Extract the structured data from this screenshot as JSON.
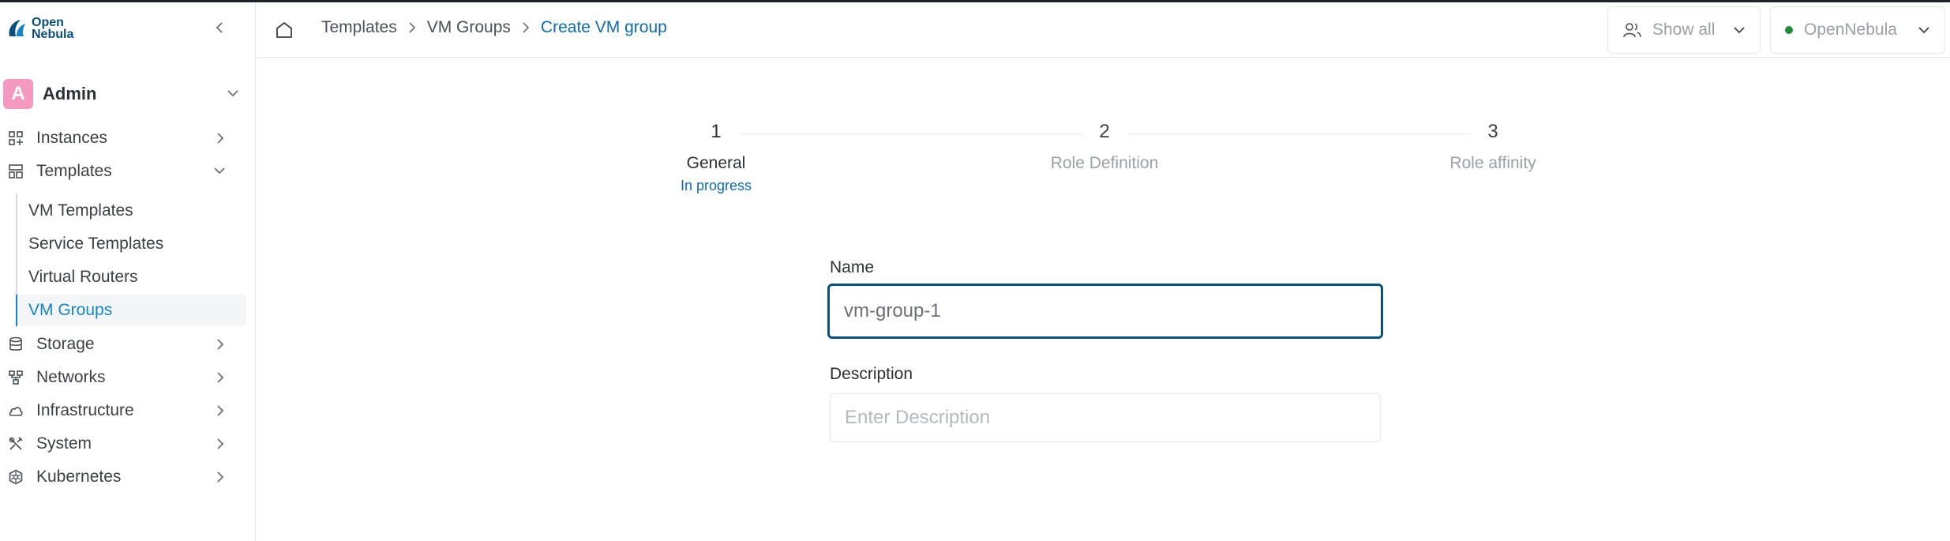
{
  "brand": {
    "logo_line1": "Open",
    "logo_line2": "Nebula"
  },
  "user": {
    "avatar_letter": "A",
    "name": "Admin"
  },
  "sidebar": {
    "items": [
      {
        "label": "Instances",
        "icon": "instances-icon",
        "expanded": false
      },
      {
        "label": "Templates",
        "icon": "templates-icon",
        "expanded": true
      },
      {
        "label": "Storage",
        "icon": "storage-icon",
        "expanded": false
      },
      {
        "label": "Networks",
        "icon": "networks-icon",
        "expanded": false
      },
      {
        "label": "Infrastructure",
        "icon": "cloud-icon",
        "expanded": false
      },
      {
        "label": "System",
        "icon": "tools-icon",
        "expanded": false
      },
      {
        "label": "Kubernetes",
        "icon": "kubernetes-icon",
        "expanded": false
      }
    ],
    "templates_sub": [
      {
        "label": "VM Templates"
      },
      {
        "label": "Service Templates"
      },
      {
        "label": "Virtual Routers"
      },
      {
        "label": "VM Groups",
        "active": true
      }
    ]
  },
  "header": {
    "breadcrumb": [
      "Templates",
      "VM Groups",
      "Create VM group"
    ],
    "group_select": "Show all",
    "zone_select": "OpenNebula"
  },
  "stepper": [
    {
      "number": "1",
      "title": "General",
      "status": "In progress"
    },
    {
      "number": "2",
      "title": "Role Definition"
    },
    {
      "number": "3",
      "title": "Role affinity"
    }
  ],
  "form": {
    "name_label": "Name",
    "name_value": "vm-group-1",
    "description_label": "Description",
    "description_placeholder": "Enter Description"
  },
  "colors": {
    "accent": "#0e6ba8",
    "active_link": "#1784c7",
    "avatar": "#f49ac1",
    "status_dot": "#1f8a3c",
    "focus_border": "#0b4f7c"
  }
}
